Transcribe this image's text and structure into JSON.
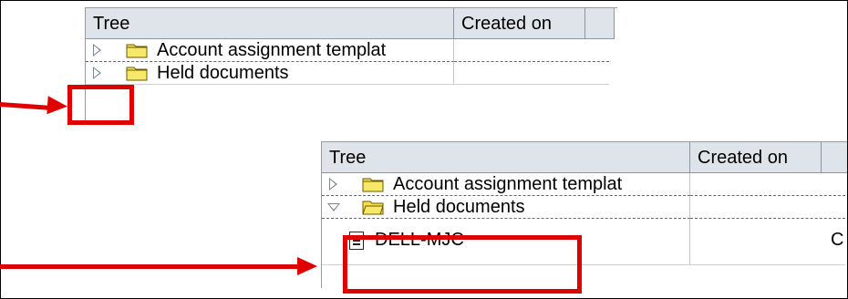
{
  "top_panel": {
    "header": {
      "tree": "Tree",
      "created_on": "Created on"
    },
    "rows": [
      {
        "label": "Account assignment templat"
      },
      {
        "label": "Held documents"
      }
    ]
  },
  "bottom_panel": {
    "header": {
      "tree": "Tree",
      "created_on": "Created on"
    },
    "rows": [
      {
        "label": "Account assignment templat"
      },
      {
        "label": "Held documents"
      },
      {
        "label": "DELL-MJC",
        "created_on": "C"
      }
    ]
  },
  "colors": {
    "highlight": "#e00000",
    "header_bg": "#dfe4ea",
    "folder": "#f5e04a"
  }
}
